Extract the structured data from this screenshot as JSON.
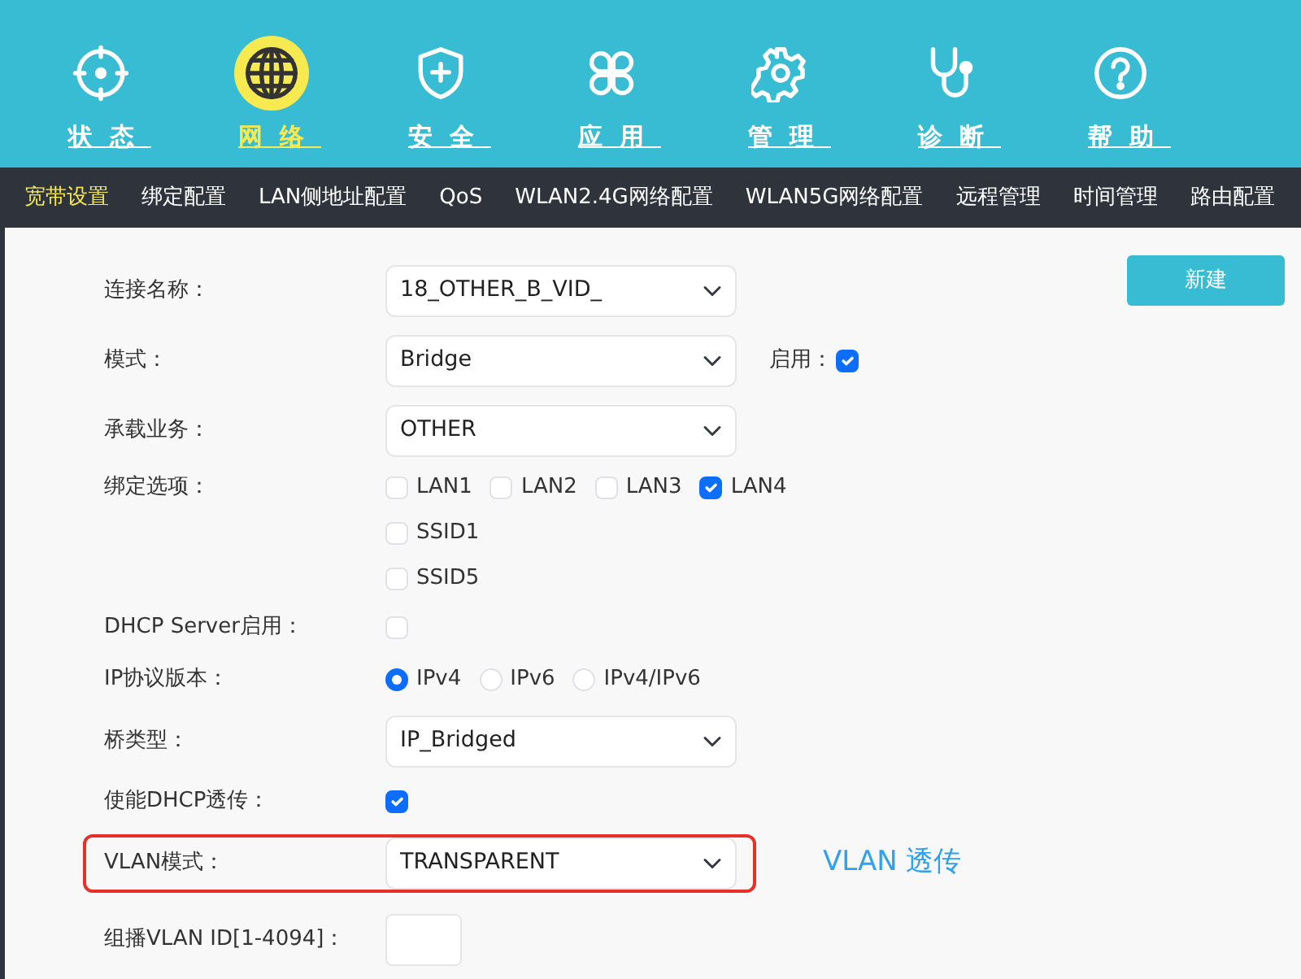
{
  "main_nav": [
    {
      "label": "状态",
      "selected": false
    },
    {
      "label": "网络",
      "selected": true
    },
    {
      "label": "安全",
      "selected": false
    },
    {
      "label": "应用",
      "selected": false
    },
    {
      "label": "管理",
      "selected": false
    },
    {
      "label": "诊断",
      "selected": false
    },
    {
      "label": "帮助",
      "selected": false
    }
  ],
  "sub_nav": [
    {
      "label": "宽带设置",
      "selected": true
    },
    {
      "label": "绑定配置",
      "selected": false
    },
    {
      "label": "LAN侧地址配置",
      "selected": false
    },
    {
      "label": "QoS",
      "selected": false
    },
    {
      "label": "WLAN2.4G网络配置",
      "selected": false
    },
    {
      "label": "WLAN5G网络配置",
      "selected": false
    },
    {
      "label": "远程管理",
      "selected": false
    },
    {
      "label": "时间管理",
      "selected": false
    },
    {
      "label": "路由配置",
      "selected": false
    }
  ],
  "new_button": "新建",
  "form": [
    {
      "kind": "select",
      "label": "连接名称：",
      "value": "18_OTHER_B_VID_"
    },
    {
      "kind": "select",
      "label": "模式：",
      "value": "Bridge",
      "enable": {
        "label": "启用：",
        "checked": true
      }
    },
    {
      "kind": "select",
      "label": "承载业务：",
      "value": "OTHER"
    },
    {
      "kind": "checkgroup",
      "label": "绑定选项：",
      "options": [
        {
          "label": "LAN1",
          "checked": false
        },
        {
          "label": "LAN2",
          "checked": false
        },
        {
          "label": "LAN3",
          "checked": false
        },
        {
          "label": "LAN4",
          "checked": true
        },
        {
          "label": "SSID1",
          "checked": false
        },
        {
          "label": "SSID5",
          "checked": false
        }
      ]
    },
    {
      "kind": "checkbox",
      "label": "DHCP Server启用：",
      "checked": false
    },
    {
      "kind": "radio",
      "label": "IP协议版本：",
      "options": [
        {
          "label": "IPv4",
          "selected": true
        },
        {
          "label": "IPv6",
          "selected": false
        },
        {
          "label": "IPv4/IPv6",
          "selected": false
        }
      ]
    },
    {
      "kind": "select",
      "label": "桥类型：",
      "value": "IP_Bridged"
    },
    {
      "kind": "checkbox",
      "label": "使能DHCP透传：",
      "checked": true
    },
    {
      "kind": "select",
      "label": "VLAN模式：",
      "value": "TRANSPARENT",
      "highlighted": true,
      "note": "VLAN 透传"
    },
    {
      "kind": "input",
      "label": "组播VLAN ID[1-4094]："
    }
  ]
}
